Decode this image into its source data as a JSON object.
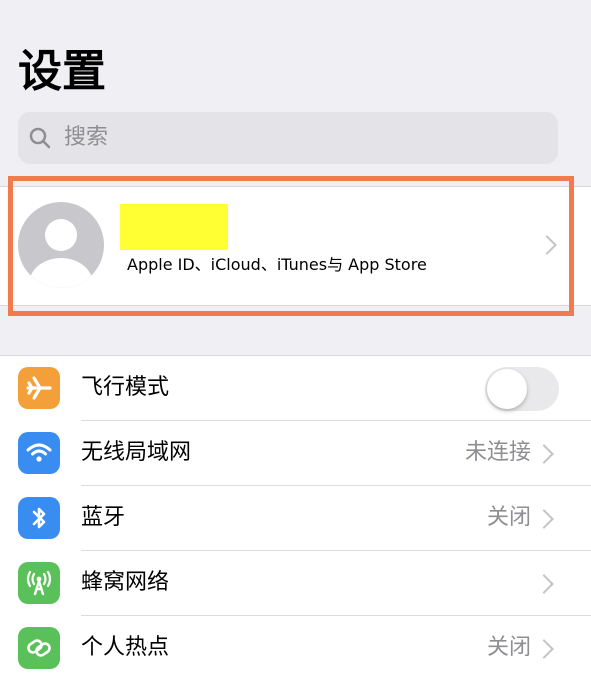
{
  "header": {
    "title": "设置"
  },
  "search": {
    "placeholder": "搜索"
  },
  "account": {
    "subtitle": "Apple ID、iCloud、iTunes与 App Store"
  },
  "settings": [
    {
      "label": "飞行模式",
      "value": "",
      "icon": "airplane-icon",
      "color": "#f4a03a",
      "control": "toggle"
    },
    {
      "label": "无线局域网",
      "value": "未连接",
      "icon": "wifi-icon",
      "color": "#3a8df0",
      "control": "chevron"
    },
    {
      "label": "蓝牙",
      "value": "关闭",
      "icon": "bluetooth-icon",
      "color": "#3a8df0",
      "control": "chevron"
    },
    {
      "label": "蜂窝网络",
      "value": "",
      "icon": "cellular-icon",
      "color": "#5ac05a",
      "control": "chevron"
    },
    {
      "label": "个人热点",
      "value": "关闭",
      "icon": "hotspot-icon",
      "color": "#5ac05a",
      "control": "chevron"
    }
  ]
}
